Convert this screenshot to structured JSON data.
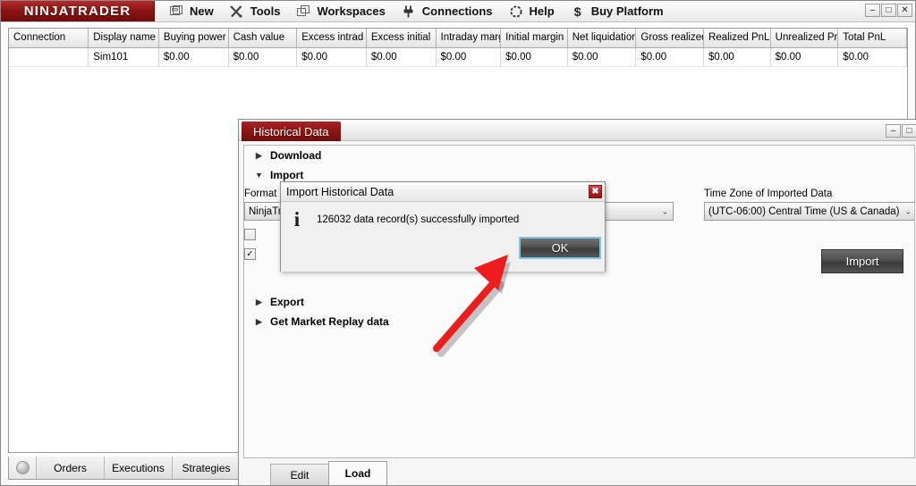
{
  "app": {
    "brand": "NINJATRADER",
    "menu": [
      {
        "label": "New",
        "icon": "new-window-icon"
      },
      {
        "label": "Tools",
        "icon": "tools-icon"
      },
      {
        "label": "Workspaces",
        "icon": "workspaces-icon"
      },
      {
        "label": "Connections",
        "icon": "plug-icon"
      },
      {
        "label": "Help",
        "icon": "help-icon"
      },
      {
        "label": "Buy Platform",
        "icon": "dollar-icon"
      }
    ],
    "window_controls": {
      "minimize": "–",
      "maximize": "□",
      "close": "✕"
    }
  },
  "accounts_grid": {
    "columns": [
      "Connection",
      "Display name",
      "Buying power",
      "Cash value",
      "Excess intrad",
      "Excess initial",
      "Intraday marg",
      "Initial margin",
      "Net liquidation",
      "Gross realized",
      "Realized PnL",
      "Unrealized Pr",
      "Total PnL"
    ],
    "rows": [
      {
        "connection": "",
        "display_name": "Sim101",
        "buying_power": "$0.00",
        "cash_value": "$0.00",
        "excess_intraday": "$0.00",
        "excess_initial": "$0.00",
        "intraday_margin": "$0.00",
        "initial_margin": "$0.00",
        "net_liquidation": "$0.00",
        "gross_realized": "$0.00",
        "realized_pnl": "$0.00",
        "unrealized_pnl": "$0.00",
        "total_pnl": "$0.00"
      }
    ]
  },
  "control_center_tabs": [
    {
      "label": "Orders"
    },
    {
      "label": "Executions"
    },
    {
      "label": "Strategies"
    }
  ],
  "historical_data_window": {
    "tab_title": "Historical Data",
    "window_controls": {
      "minimize": "–",
      "maximize": "□"
    },
    "sections": [
      {
        "label": "Download",
        "expanded": false,
        "tri": "▶"
      },
      {
        "label": "Import",
        "expanded": true,
        "tri": "▼"
      },
      {
        "label": "Export",
        "expanded": false,
        "tri": "▶"
      },
      {
        "label": "Get Market Replay data",
        "expanded": false,
        "tri": "▶"
      }
    ],
    "import": {
      "format_label": "Format",
      "format_value": "NinjaTrader",
      "format_caret": "⌄",
      "timezone_label": "Time Zone of Imported Data",
      "timezone_value": "(UTC-06:00) Central Time (US & Canada)",
      "timezone_caret": "⌄",
      "checkbox1": {
        "checked": false,
        "mark": ""
      },
      "checkbox2": {
        "checked": true,
        "mark": "✓"
      },
      "import_button": "Import"
    },
    "bottom_tabs": [
      {
        "label": "Edit",
        "active": false
      },
      {
        "label": "Load",
        "active": true
      }
    ]
  },
  "dialog": {
    "title": "Import Historical Data",
    "close_glyph": "✖",
    "icon": "info-icon",
    "icon_glyph": "i",
    "message": "126032 data record(s) successfully imported",
    "ok_label": "OK"
  },
  "annotation": {
    "arrow_color": "#ee1c1c",
    "name": "red-arrow-pointing-to-ok-button"
  }
}
